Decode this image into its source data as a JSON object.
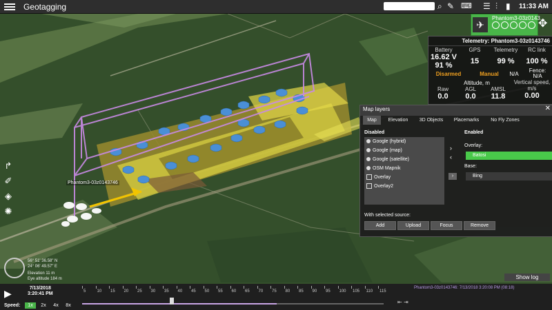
{
  "app": {
    "title": "Geotagging",
    "clock": "11:33 AM"
  },
  "drone_card": {
    "name": "Phantom3-03z0143..."
  },
  "telemetry": {
    "title": "Telemetry: Phantom3-03z0143746",
    "battery": {
      "label": "Battery",
      "voltage": "16.62 V",
      "percent": "91 %"
    },
    "gps": {
      "label": "GPS",
      "value": "15"
    },
    "tele": {
      "label": "Telemetry",
      "value": "99 %"
    },
    "rc": {
      "label": "RC link",
      "value": "100 %"
    },
    "status_disarmed": "Disarmed",
    "status_manual": "Manual",
    "na": "N/A",
    "fence": {
      "label": "Fence:",
      "value": "N/A"
    },
    "altitude_label": "Altitude, m",
    "raw": {
      "label": "Raw",
      "value": "0.0"
    },
    "agl": {
      "label": "AGL",
      "value": "0.0"
    },
    "amsl": {
      "label": "AMSL",
      "value": "11.8"
    },
    "vspeed": {
      "label": "Vertical speed,",
      "unit": "m/s",
      "value": "0.00"
    }
  },
  "layers": {
    "title": "Map layers",
    "tabs": [
      "Map",
      "Elevation",
      "3D Objects",
      "Placemarks",
      "No Fly Zones"
    ],
    "disabled_label": "Disabled",
    "enabled_label": "Enabled",
    "disabled_items": [
      "Google (hybrid)",
      "Google (map)",
      "Google (satellite)",
      "OSM Mapnik",
      "Overlay",
      "Overlay2"
    ],
    "overlay_label": "Overlay:",
    "overlay_item": "Batosi",
    "base_label": "Base:",
    "base_item": "Bing",
    "selected_label": "With selected source:",
    "buttons": [
      "Add",
      "Upload",
      "Focus",
      "Remove"
    ]
  },
  "map": {
    "drone_label": "Phantom3-03z0143746",
    "coord_lat": "56° 51' 36.58\" N",
    "coord_lon": "24° 06' 49.57\" E",
    "elevation": "Elevation 11 m",
    "eye_alt": "Eye altitude 184 m"
  },
  "bottom": {
    "show_log": "Show log",
    "date": "7/13/2018",
    "time": "3:20:41 PM",
    "speed_label": "Speed:",
    "speeds": [
      "1x",
      "2x",
      "4x",
      "8x"
    ],
    "track_info": "Phantom3-03z0143746: 7/13/2018 3:20:08 PM (08:18)",
    "ticks": [
      "5",
      "10",
      "15",
      "20",
      "25",
      "30",
      "35",
      "40",
      "45",
      "50",
      "55",
      "60",
      "65",
      "70",
      "75",
      "80",
      "85",
      "90",
      "95",
      "100",
      "105",
      "110",
      "115"
    ]
  }
}
